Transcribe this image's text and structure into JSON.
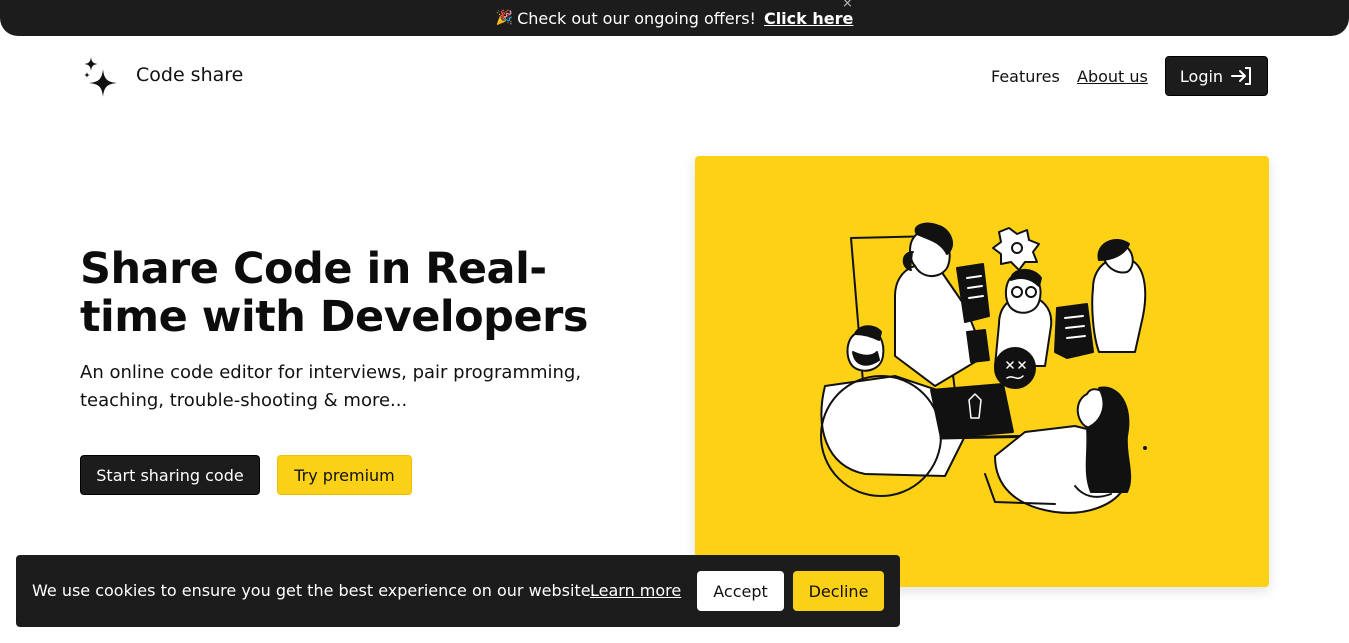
{
  "banner": {
    "emoji": "🎉",
    "text": "Check out our ongoing offers!",
    "link_label": "Click here",
    "close_icon": "×"
  },
  "header": {
    "logo_icon": "sparkles-icon",
    "brand": "Code share",
    "nav": {
      "features": "Features",
      "about": "About us",
      "login": "Login",
      "login_icon": "sign-in-icon"
    }
  },
  "hero": {
    "title": "Share Code in Real-time with Developers",
    "subtitle": "An online code editor for interviews, pair programming, teaching, trouble-shooting & more...",
    "primary_button": "Start sharing code",
    "secondary_button": "Try premium"
  },
  "illustration": {
    "background_color": "#fcd116",
    "subject": "developers-collaborating-illustration"
  },
  "cookie_banner": {
    "text": "We use cookies to ensure you get the best experience on our website.",
    "learn_more": "Learn more",
    "accept": "Accept",
    "decline": "Decline"
  },
  "colors": {
    "dark": "#1c1c1c",
    "accent": "#fbd117",
    "white": "#ffffff"
  }
}
